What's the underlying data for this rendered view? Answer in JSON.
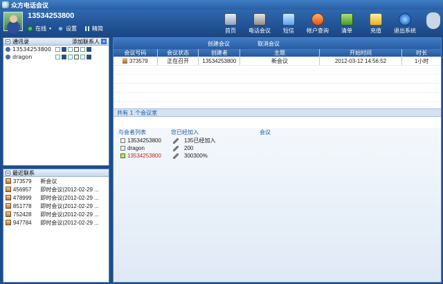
{
  "window": {
    "title": "众方电话会议"
  },
  "user": {
    "phone": "13534253800",
    "status": "在线",
    "settings": "设置",
    "simple": "精简"
  },
  "toolbar": [
    {
      "label": "首页",
      "icon": "home-icon"
    },
    {
      "label": "电话会议",
      "icon": "conference-icon"
    },
    {
      "label": "短信",
      "icon": "sms-icon"
    },
    {
      "label": "帐户查询",
      "icon": "account-icon"
    },
    {
      "label": "清单",
      "icon": "list-icon"
    },
    {
      "label": "充值",
      "icon": "recharge-icon"
    },
    {
      "label": "退出系统",
      "icon": "power-icon"
    }
  ],
  "contacts": {
    "title": "通讯录",
    "add_label": "添加联系人",
    "items": [
      {
        "name": "13534253800"
      },
      {
        "name": "dragon"
      }
    ]
  },
  "recent": {
    "title": "最近联系",
    "items": [
      {
        "id": "373579",
        "name": "新会议"
      },
      {
        "id": "456957",
        "name": "即时会议(2012-02-29 ..."
      },
      {
        "id": "478999",
        "name": "即时会议(2012-02-29 ..."
      },
      {
        "id": "851778",
        "name": "即时会议(2012-02-29 ..."
      },
      {
        "id": "752428",
        "name": "即时会议(2012-02-29 ..."
      },
      {
        "id": "947784",
        "name": "即时会议(2012-02-29 ..."
      }
    ]
  },
  "meeting": {
    "create_label": "创建会议",
    "cancel_label": "取消会议",
    "columns": [
      "会议号码",
      "会议状态",
      "创建者",
      "主题",
      "开始时间",
      "时长"
    ],
    "rows": [
      {
        "number": "373579",
        "status": "正在召开",
        "creator": "13534253800",
        "topic": "新会议",
        "start": "2012-03-12 14:56:52",
        "duration": "1小时"
      }
    ],
    "count_text": "共有 1 个会议室"
  },
  "members": {
    "header_list": "与会者列表",
    "header_joined": "您已经加入",
    "header_meeting": "会议",
    "items": [
      {
        "name": "13534253800",
        "status": "135已经加入"
      },
      {
        "name": "dragon",
        "status": "200"
      },
      {
        "name": "13534253800",
        "status": "300300%"
      }
    ]
  },
  "colors": {
    "accent": "#2a5da3",
    "active_member": "#c8201c"
  }
}
